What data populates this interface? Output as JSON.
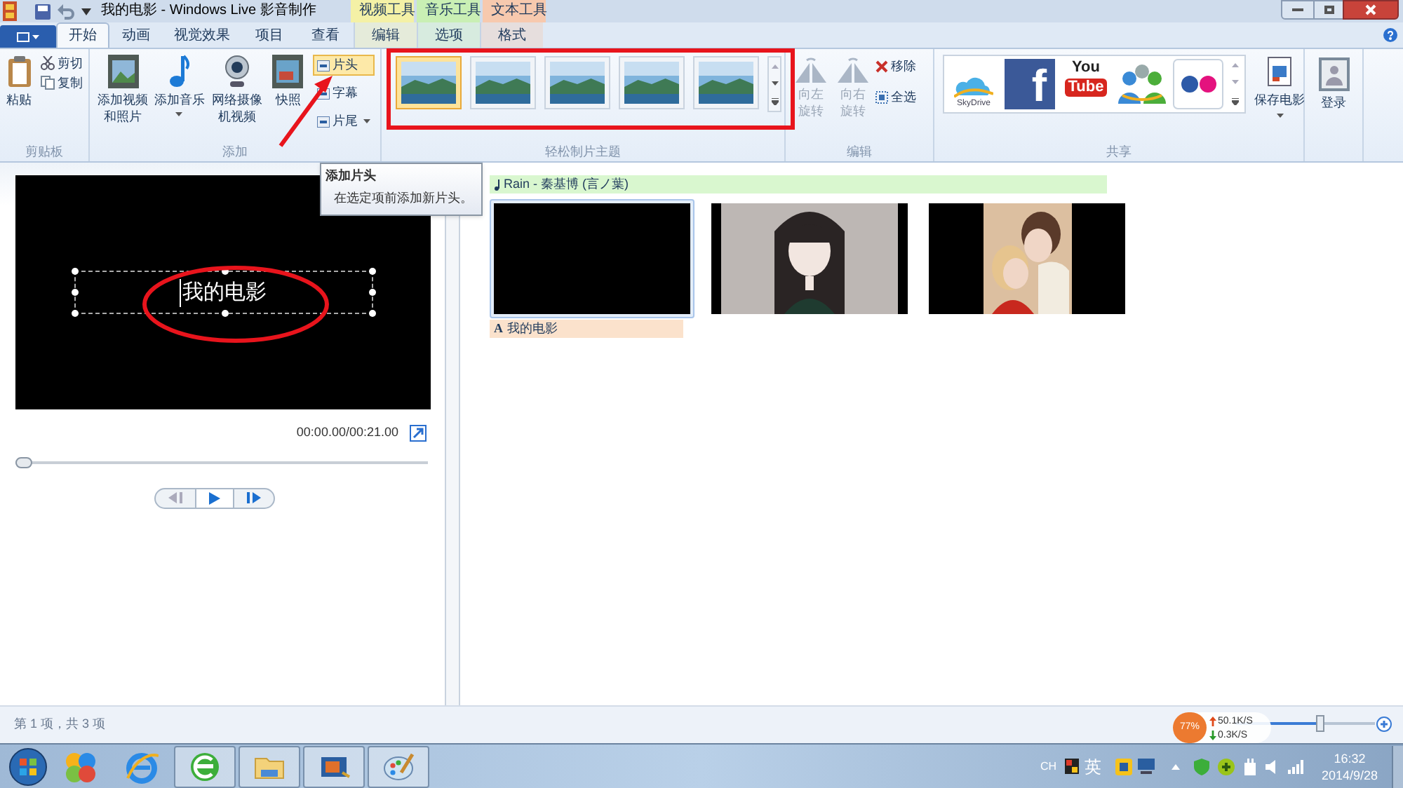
{
  "window": {
    "title": "我的电影 - Windows Live 影音制作"
  },
  "contextual_tabs": [
    {
      "label": "视频工具",
      "color": "#f4f1a6"
    },
    {
      "label": "音乐工具",
      "color": "#c9efb4"
    },
    {
      "label": "文本工具",
      "color": "#f7c9ae"
    }
  ],
  "tabs": [
    {
      "label": "开始",
      "selected": true
    },
    {
      "label": "动画",
      "selected": false
    },
    {
      "label": "视觉效果",
      "selected": false
    },
    {
      "label": "项目",
      "selected": false
    },
    {
      "label": "查看",
      "selected": false
    },
    {
      "label": "编辑",
      "selected": false
    },
    {
      "label": "选项",
      "selected": false
    },
    {
      "label": "格式",
      "selected": false
    }
  ],
  "ribbon": {
    "clipboard": {
      "label": "剪贴板",
      "paste": "粘贴",
      "cut": "剪切",
      "copy": "复制"
    },
    "add": {
      "label": "添加",
      "big": [
        {
          "lines": [
            "添加视频",
            "和照片"
          ],
          "dropdown": false
        },
        {
          "lines": [
            "添加音乐"
          ],
          "dropdown": true
        },
        {
          "lines": [
            "网络摄像",
            "机视频"
          ],
          "dropdown": false
        },
        {
          "lines": [
            "快照"
          ],
          "dropdown": false
        }
      ],
      "small": [
        {
          "label": "片头",
          "hover": true,
          "dropdown": false
        },
        {
          "label": "字幕",
          "hover": false,
          "dropdown": false
        },
        {
          "label": "片尾",
          "hover": false,
          "dropdown": true
        }
      ]
    },
    "themes": {
      "label": "轻松制片主题",
      "items": [
        {
          "selected": true
        },
        {
          "selected": false
        },
        {
          "selected": false
        },
        {
          "selected": false
        },
        {
          "selected": false
        }
      ]
    },
    "edit": {
      "label": "编辑",
      "rotate_left": {
        "lines": [
          "向左",
          "旋转"
        ],
        "disabled": true
      },
      "rotate_right": {
        "lines": [
          "向右",
          "旋转"
        ],
        "disabled": true
      },
      "remove": "移除",
      "select_all": "全选"
    },
    "share": {
      "label": "共享",
      "skydrive": "SkyDrive",
      "facebook": "f",
      "youtube_top": "You",
      "youtube_bottom": "Tube",
      "save_movie": "保存电影"
    },
    "sign_in": "登录"
  },
  "tooltip": {
    "title": "添加片头",
    "body": "在选定项前添加新片头。"
  },
  "preview": {
    "caption": "我的电影",
    "time": "00:00.00/00:21.00",
    "seek": {
      "level": 0
    }
  },
  "storyboard": {
    "music": "Rain - 秦基博 (言ノ葉)",
    "clips": [
      {
        "kind": "black",
        "selected": true
      },
      {
        "kind": "picture",
        "selected": false
      },
      {
        "kind": "picture",
        "selected": false
      }
    ],
    "caption_icon": "A",
    "title_caption": "我的电影"
  },
  "status_bar": {
    "text": "第 1 项，共 3 项",
    "zoom": {
      "level": 0.62
    }
  },
  "net_widget": {
    "percent": "77%",
    "up": "50.1K/S",
    "down": "0.3K/S"
  },
  "tray": {
    "lang": "CH",
    "ime": "英",
    "time": "16:32",
    "date": "2014/9/28"
  }
}
